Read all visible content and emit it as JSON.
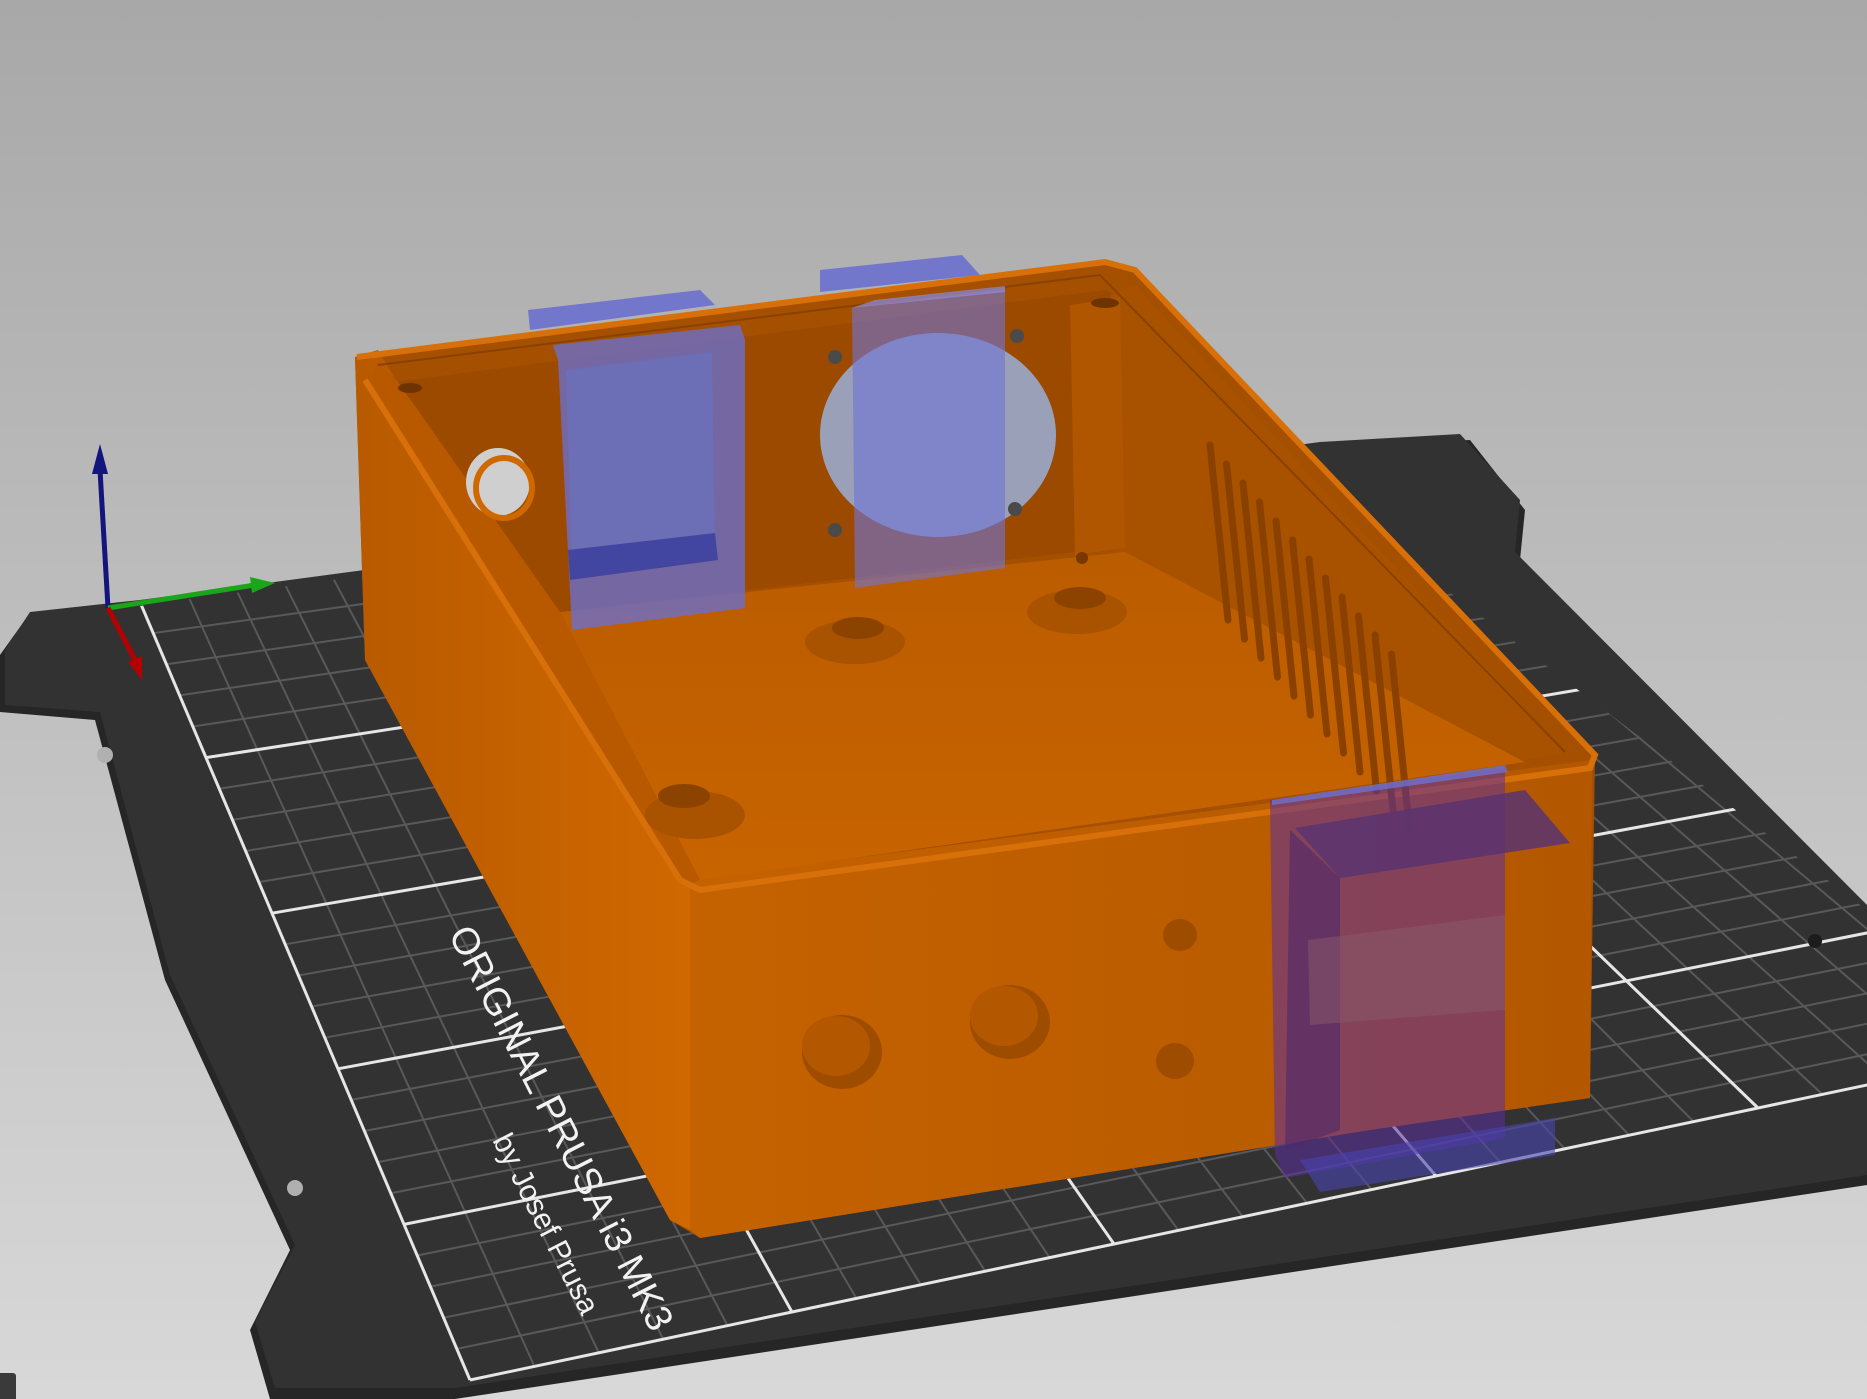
{
  "viewport": {
    "background_top": "#a9a9a9",
    "background_bottom": "#d6d6d6",
    "accent_part": "#c25e00",
    "modifier_color": "#6f72d6"
  },
  "bed": {
    "label_line1": "ORIGINAL PRUSA i3  MK3",
    "label_line2": "by Josef Prusa",
    "color": "#2e2e2e",
    "grid_color": "#5a5a5a"
  },
  "axes": {
    "x_color": "#b40000",
    "y_color": "#1aa51a",
    "z_color": "#14147d"
  },
  "icons": {
    "corner": "collapse-sidebar-icon"
  }
}
